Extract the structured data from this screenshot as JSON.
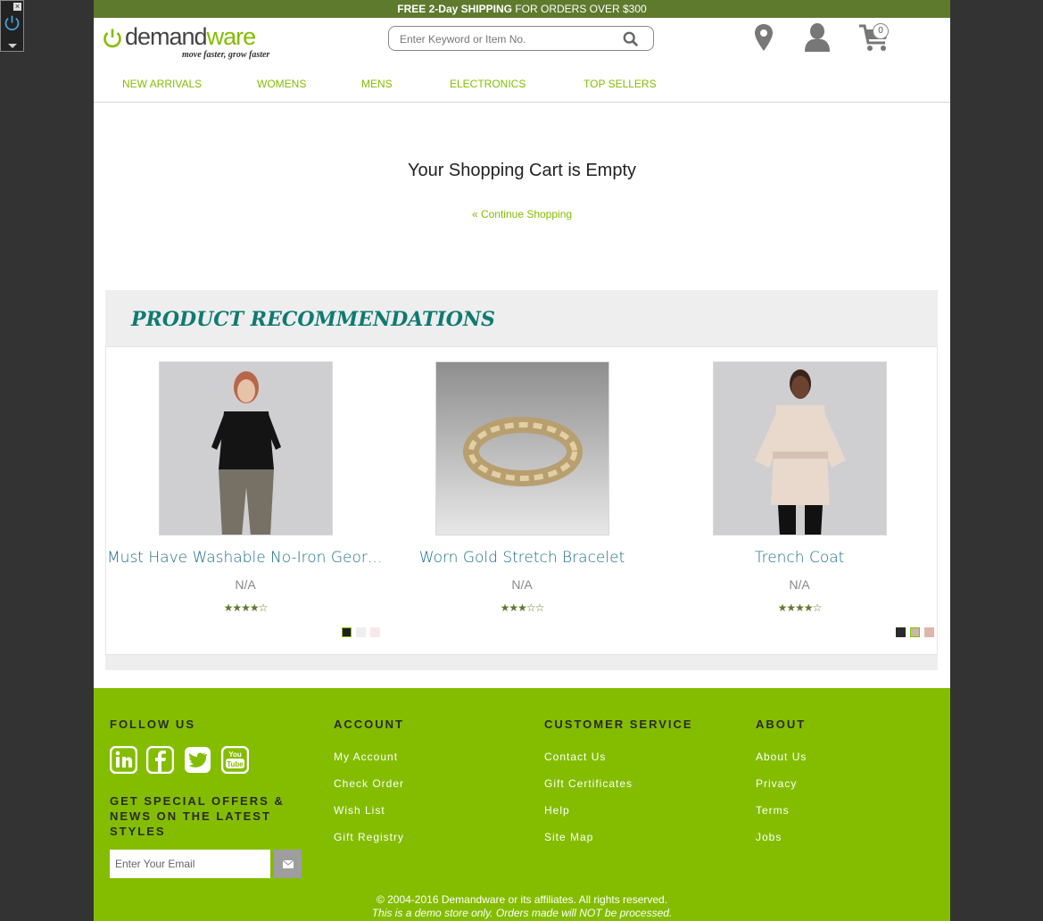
{
  "promo": {
    "bold": "FREE 2-Day SHIPPING",
    "rest": " FOR ORDERS OVER $300"
  },
  "logo": {
    "word_a": "demand",
    "word_b": "ware",
    "tagline": "move faster, grow faster"
  },
  "search": {
    "placeholder": "Enter Keyword or Item No."
  },
  "cart": {
    "count": "0"
  },
  "nav": [
    "NEW ARRIVALS",
    "WOMENS",
    "MENS",
    "ELECTRONICS",
    "TOP SELLERS"
  ],
  "main": {
    "title": "Your Shopping Cart is Empty",
    "continue": "« Continue Shopping"
  },
  "recommendations": {
    "heading": "PRODUCT RECOMMENDATIONS",
    "products": [
      {
        "name": "Must Have Washable No-Iron Georg...",
        "price": "N/A",
        "stars": "★★★★☆",
        "rating": 3.5,
        "swatches": [
          "#1e1e1e",
          "#eeeeee",
          "#f7e8ea"
        ]
      },
      {
        "name": "Worn Gold Stretch Bracelet",
        "price": "N/A",
        "stars": "★★★☆☆",
        "rating": 2.5,
        "swatches": []
      },
      {
        "name": "Trench Coat",
        "price": "N/A",
        "stars": "★★★★☆",
        "rating": 4.5,
        "swatches": [
          "#2a2a2a",
          "#c9b8a8",
          "#e0b5aa"
        ]
      }
    ]
  },
  "footer": {
    "follow": "FOLLOW US",
    "offers": "GET SPECIAL OFFERS & NEWS ON THE LATEST STYLES",
    "email_placeholder": "Enter Your Email",
    "account": {
      "title": "ACCOUNT",
      "links": [
        "My Account",
        "Check Order",
        "Wish List",
        "Gift Registry"
      ]
    },
    "service": {
      "title": "CUSTOMER SERVICE",
      "links": [
        "Contact Us",
        "Gift Certificates",
        "Help",
        "Site Map"
      ]
    },
    "about": {
      "title": "ABOUT",
      "links": [
        "About Us",
        "Privacy",
        "Terms",
        "Jobs"
      ]
    },
    "copyright": "© 2004-2016 Demandware or its affiliates. All rights reserved.",
    "demo": "This is a demo store only. Orders made will NOT be processed."
  },
  "colors": {
    "accent": "#84bd00",
    "promo_bar": "#5e7a2d",
    "teal": "#0f7a72",
    "link_blue": "#1a6f8a"
  }
}
